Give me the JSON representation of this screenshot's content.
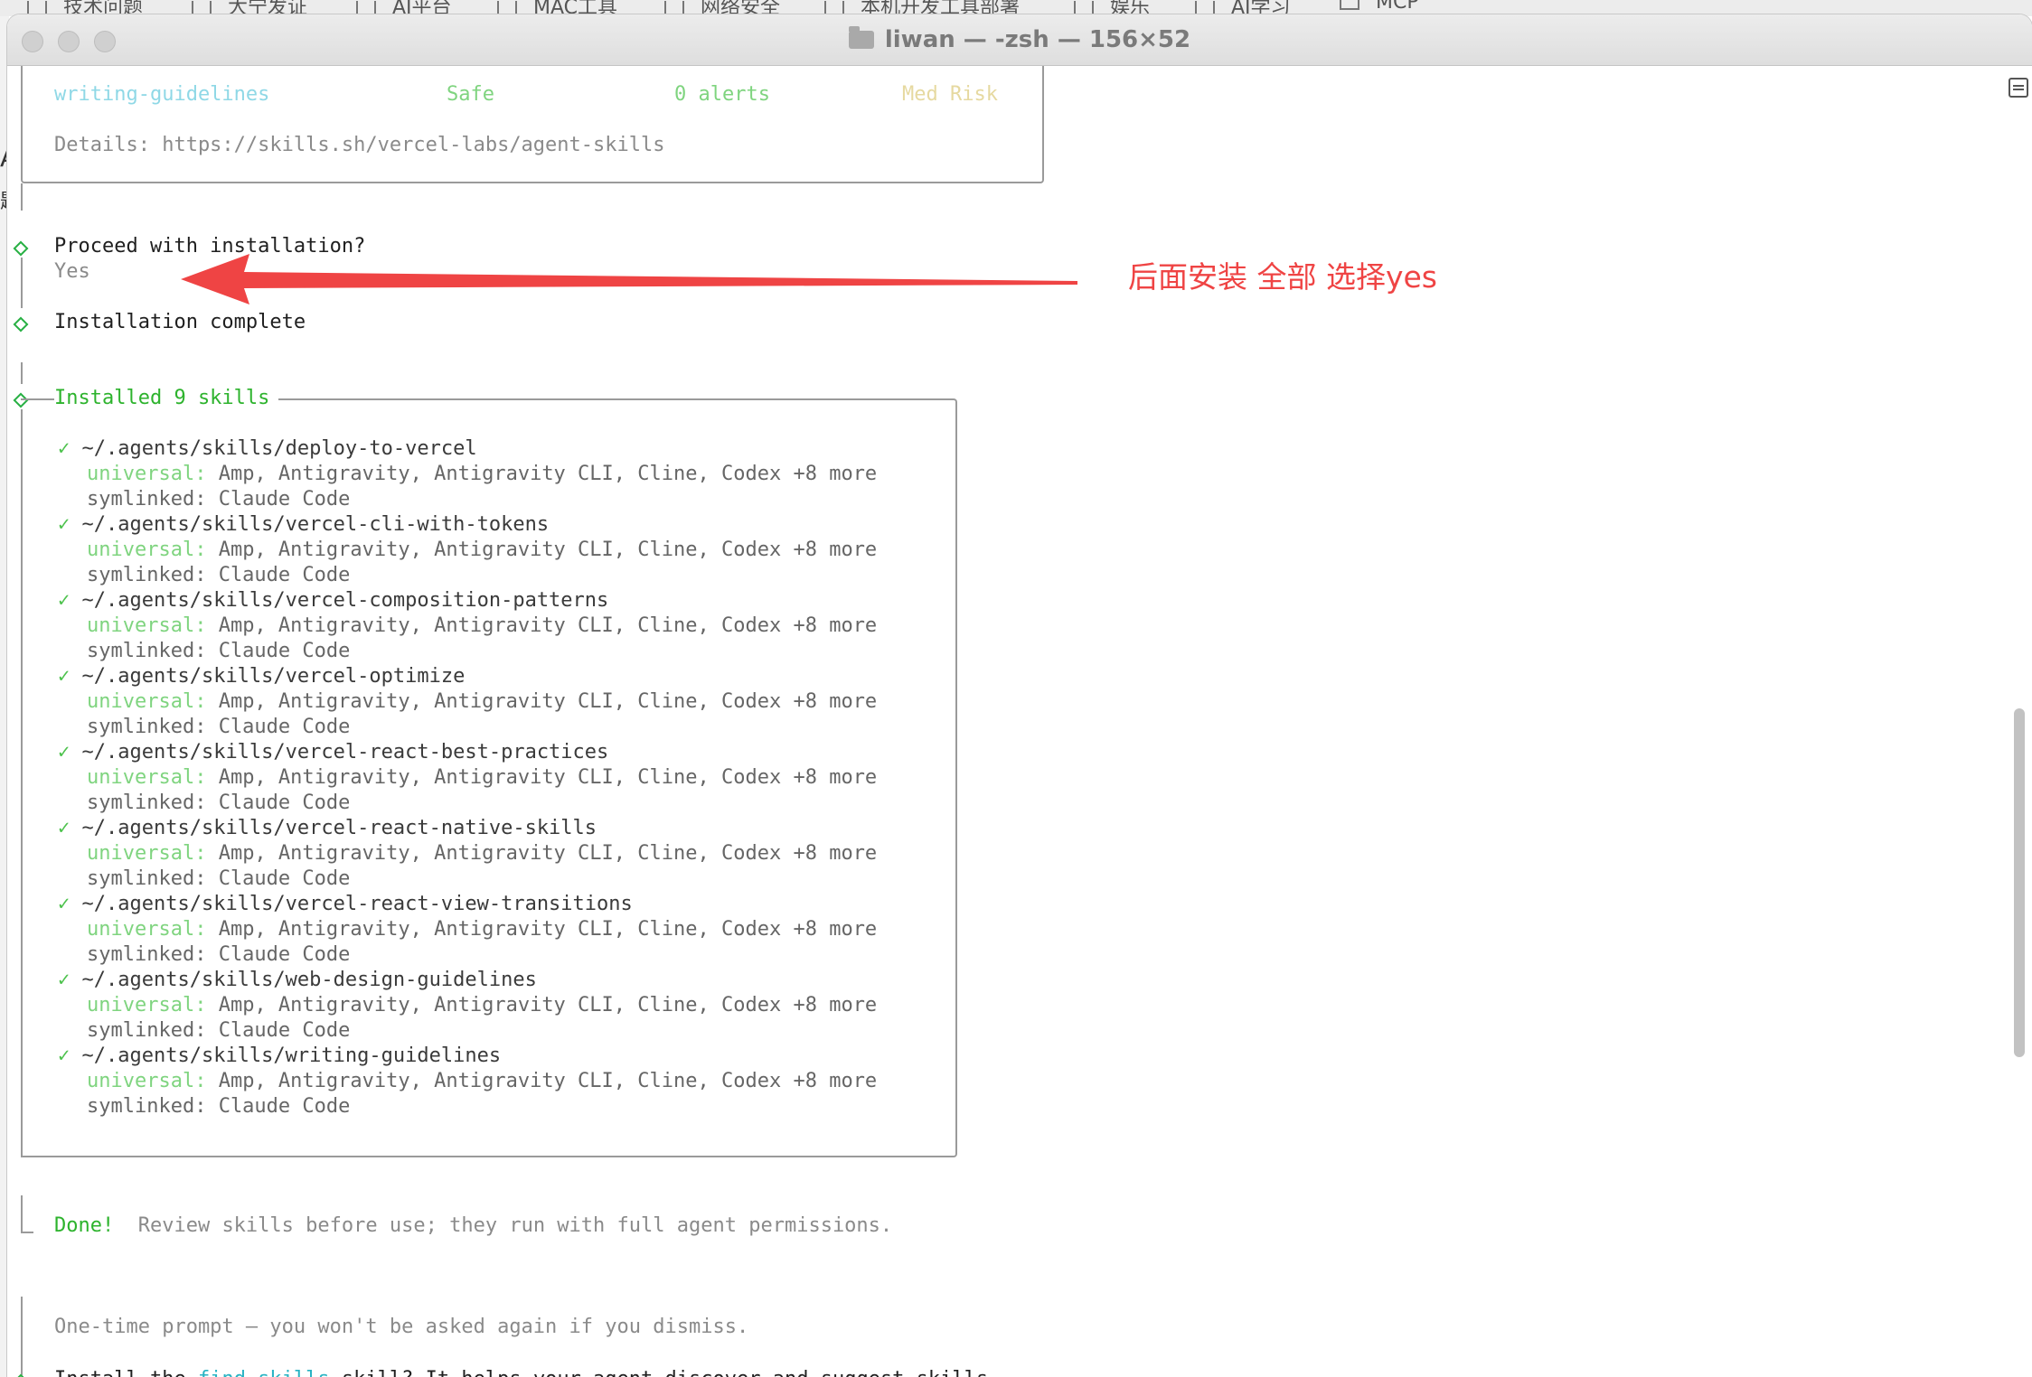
{
  "bookmarks": [
    "技术问题",
    "大宁发证",
    "AI平台",
    "MAC工具",
    "网络安全",
    "本机开发工具部署",
    "娱乐",
    "AI学习",
    "MCP"
  ],
  "background_glyphs": [
    "A",
    "题"
  ],
  "window": {
    "title": "liwan — -zsh — 156×52"
  },
  "terminal": {
    "table_row": {
      "skill": "writing-guidelines",
      "status": "Safe",
      "alerts": "0 alerts",
      "risk": "Med Risk"
    },
    "details": "Details: https://skills.sh/vercel-labs/agent-skills",
    "proceed_question": "Proceed with installation?",
    "proceed_answer": "Yes",
    "install_complete": "Installation complete",
    "installed_header": "Installed 9 skills",
    "universal_label": "universal:",
    "universal_agents": " Amp, Antigravity, Antigravity CLI, Cline, Codex +8 more",
    "symlinked": "symlinked: Claude Code",
    "check": "✓",
    "skills": [
      "~/.agents/skills/deploy-to-vercel",
      "~/.agents/skills/vercel-cli-with-tokens",
      "~/.agents/skills/vercel-composition-patterns",
      "~/.agents/skills/vercel-optimize",
      "~/.agents/skills/vercel-react-best-practices",
      "~/.agents/skills/vercel-react-native-skills",
      "~/.agents/skills/vercel-react-view-transitions",
      "~/.agents/skills/web-design-guidelines",
      "~/.agents/skills/writing-guidelines"
    ],
    "done_label": "Done!",
    "done_text": "  Review skills before use; they run with full agent permissions.",
    "one_time": "One-time prompt — you won't be asked again if you dismiss.",
    "install_prefix": "Install the ",
    "install_link": "find-skills",
    "install_suffix": " skill? It helps your agent discover and suggest skills."
  },
  "annotation": {
    "text": "后面安装 全部 选择yes",
    "color": "#ef4444"
  },
  "colors": {
    "green": "#2db32d",
    "cyan": "#27b3c3",
    "annotation_red": "#ef4444"
  }
}
